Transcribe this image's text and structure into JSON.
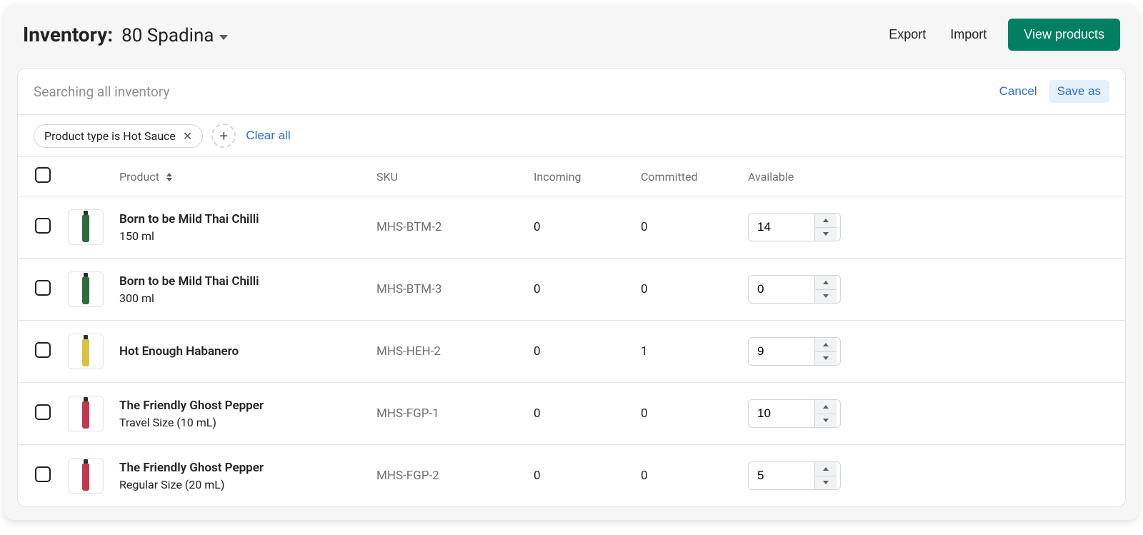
{
  "header": {
    "title_prefix": "Inventory:",
    "location": "80 Spadina",
    "export": "Export",
    "import": "Import",
    "view_products": "View products"
  },
  "search": {
    "placeholder": "Searching all inventory",
    "cancel": "Cancel",
    "save_as": "Save as"
  },
  "filters": {
    "chip_label": "Product type is Hot Sauce",
    "clear_all": "Clear all"
  },
  "columns": {
    "product": "Product",
    "sku": "SKU",
    "incoming": "Incoming",
    "committed": "Committed",
    "available": "Available"
  },
  "rows": [
    {
      "name": "Born to be Mild Thai Chilli",
      "variant": "150 ml",
      "sku": "MHS-BTM-2",
      "incoming": "0",
      "committed": "0",
      "available": "14",
      "color": "#2e6b3e"
    },
    {
      "name": "Born to be Mild Thai Chilli",
      "variant": "300 ml",
      "sku": "MHS-BTM-3",
      "incoming": "0",
      "committed": "0",
      "available": "0",
      "color": "#2e6b3e"
    },
    {
      "name": "Hot Enough Habanero",
      "variant": "",
      "sku": "MHS-HEH-2",
      "incoming": "0",
      "committed": "1",
      "available": "9",
      "color": "#d9c23c"
    },
    {
      "name": "The Friendly Ghost Pepper",
      "variant": "Travel Size (10 mL)",
      "sku": "MHS-FGP-1",
      "incoming": "0",
      "committed": "0",
      "available": "10",
      "color": "#c0394b"
    },
    {
      "name": "The Friendly Ghost Pepper",
      "variant": "Regular Size (20 mL)",
      "sku": "MHS-FGP-2",
      "incoming": "0",
      "committed": "0",
      "available": "5",
      "color": "#c0394b"
    }
  ]
}
